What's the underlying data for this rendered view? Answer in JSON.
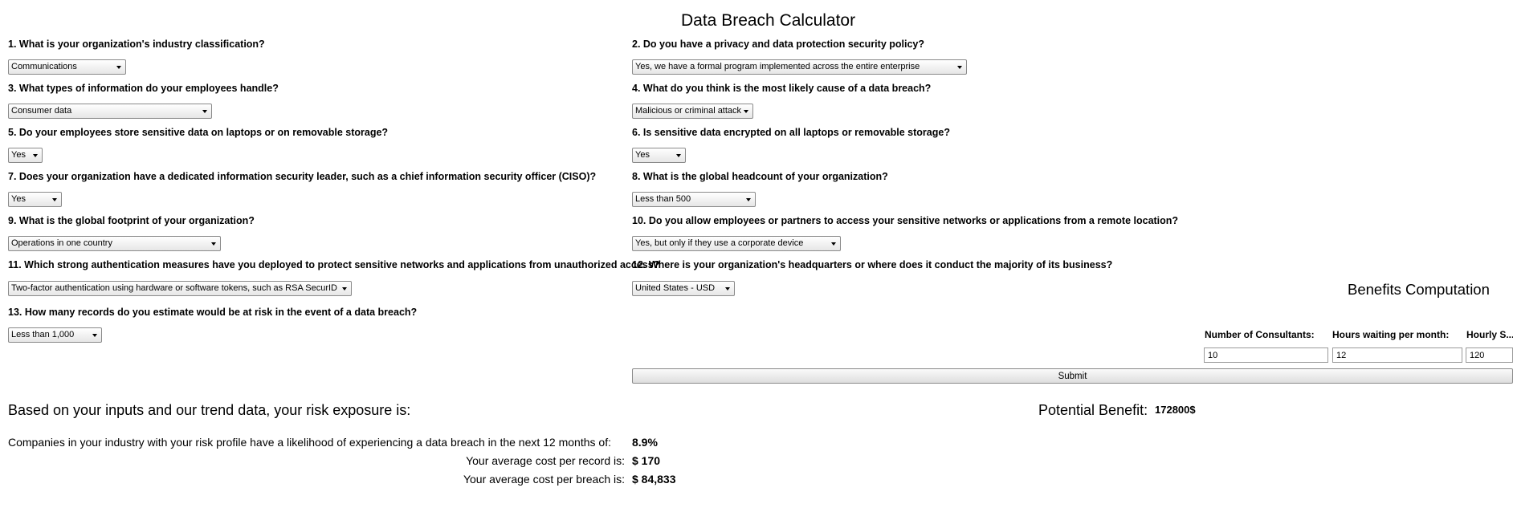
{
  "page": {
    "title": "Data Breach Calculator"
  },
  "questions": [
    {
      "label": "1. What is your organization's industry classification?",
      "value": "Communications"
    },
    {
      "label": "2. Do you have a privacy and data protection security policy?",
      "value": "Yes, we have a formal program implemented across the entire enterprise"
    },
    {
      "label": "3. What types of information do your employees handle?",
      "value": "Consumer data"
    },
    {
      "label": "4. What do you think is the most likely cause of a data breach?",
      "value": "Malicious or criminal attack"
    },
    {
      "label": "5. Do your employees store sensitive data on laptops or on removable storage?",
      "value": "Yes"
    },
    {
      "label": "6. Is sensitive data encrypted on all laptops or removable storage?",
      "value": "Yes"
    },
    {
      "label": "7. Does your organization have a dedicated information security leader, such as a chief information security officer (CISO)?",
      "value": "Yes"
    },
    {
      "label": "8. What is the global headcount of your organization?",
      "value": "Less than 500"
    },
    {
      "label": "9. What is the global footprint of your organization?",
      "value": "Operations in one country"
    },
    {
      "label": "10. Do you allow employees or partners to access your sensitive networks or applications from a remote location?",
      "value": "Yes, but only if they use a corporate device"
    },
    {
      "label": "11. Which strong authentication measures have you deployed to protect sensitive networks and applications from unauthorized access?",
      "value": "Two-factor authentication using hardware or software tokens, such as RSA SecurID"
    },
    {
      "label": "12. Where is your organization's headquarters or where does it conduct the majority of its business?",
      "value": "United States - USD"
    },
    {
      "label": "13. How many records do you estimate would be at risk in the event of a data breach?",
      "value": "Less than 1,000"
    }
  ],
  "benefits": {
    "title": "Benefits Computation",
    "fields": [
      {
        "label": "Number of Consultants:",
        "value": "10"
      },
      {
        "label": "Hours waiting per month:",
        "value": "12"
      },
      {
        "label": "Hourly S...",
        "value": "120"
      }
    ],
    "submit_label": "Submit",
    "potential_label": "Potential Benefit:",
    "potential_value": "172800$"
  },
  "results": {
    "heading": "Based on your inputs and our trend data, your risk exposure is:",
    "likelihood_label": "Companies in your industry with your risk profile have a likelihood of experiencing a data breach in the next 12 months of:",
    "likelihood_value": "8.9%",
    "cost_record_label": "Your average cost per record is:",
    "cost_record_value": "$ 170",
    "cost_breach_label": "Your average cost per breach is:",
    "cost_breach_value": "$ 84,833"
  }
}
